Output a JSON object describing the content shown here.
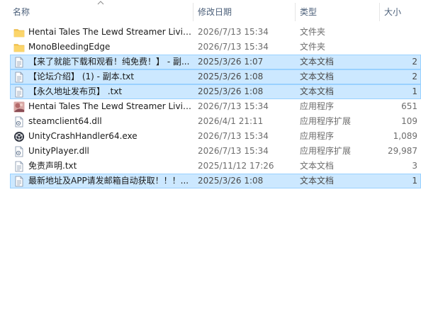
{
  "columns": {
    "name": "名称",
    "date": "修改日期",
    "type": "类型",
    "size": "大小"
  },
  "files": [
    {
      "name": "Hentai Tales The Lewd Streamer Livin...",
      "date": "2026/7/13 15:34",
      "type": "文件夹",
      "size": "",
      "icon": "folder-icon",
      "selected": false
    },
    {
      "name": "MonoBleedingEdge",
      "date": "2026/7/13 15:34",
      "type": "文件夹",
      "size": "",
      "icon": "folder-icon",
      "selected": false
    },
    {
      "name": "【来了就能下载和观看！纯免费！】 - 副...",
      "date": "2025/3/26 1:07",
      "type": "文本文档",
      "size": "2",
      "icon": "text-file-icon",
      "selected": true
    },
    {
      "name": "【论坛介绍】 (1) - 副本.txt",
      "date": "2025/3/26 1:08",
      "type": "文本文档",
      "size": "2",
      "icon": "text-file-icon",
      "selected": true
    },
    {
      "name": "【永久地址发布页】 .txt",
      "date": "2025/3/26 1:08",
      "type": "文本文档",
      "size": "1",
      "icon": "text-file-icon",
      "selected": true
    },
    {
      "name": "Hentai Tales The Lewd Streamer Livin...",
      "date": "2026/7/13 15:34",
      "type": "应用程序",
      "size": "651",
      "icon": "app-thumbnail-icon",
      "selected": false
    },
    {
      "name": "steamclient64.dll",
      "date": "2026/4/1 21:11",
      "type": "应用程序扩展",
      "size": "109",
      "icon": "dll-file-icon",
      "selected": false
    },
    {
      "name": "UnityCrashHandler64.exe",
      "date": "2026/7/13 15:34",
      "type": "应用程序",
      "size": "1,089",
      "icon": "unity-icon",
      "selected": false
    },
    {
      "name": "UnityPlayer.dll",
      "date": "2026/7/13 15:34",
      "type": "应用程序扩展",
      "size": "29,987",
      "icon": "dll-file-icon",
      "selected": false
    },
    {
      "name": "免责声明.txt",
      "date": "2025/11/12 17:26",
      "type": "文本文档",
      "size": "3",
      "icon": "text-file-icon",
      "selected": false
    },
    {
      "name": "最新地址及APP请发邮箱自动获取！！！...",
      "date": "2025/3/26 1:08",
      "type": "文本文档",
      "size": "1",
      "icon": "text-file-icon",
      "selected": true
    }
  ],
  "colors": {
    "selection_bg": "#cce8ff",
    "selection_border": "#99d1ff",
    "header_text": "#4c607a",
    "folder": "#f5c44e"
  }
}
